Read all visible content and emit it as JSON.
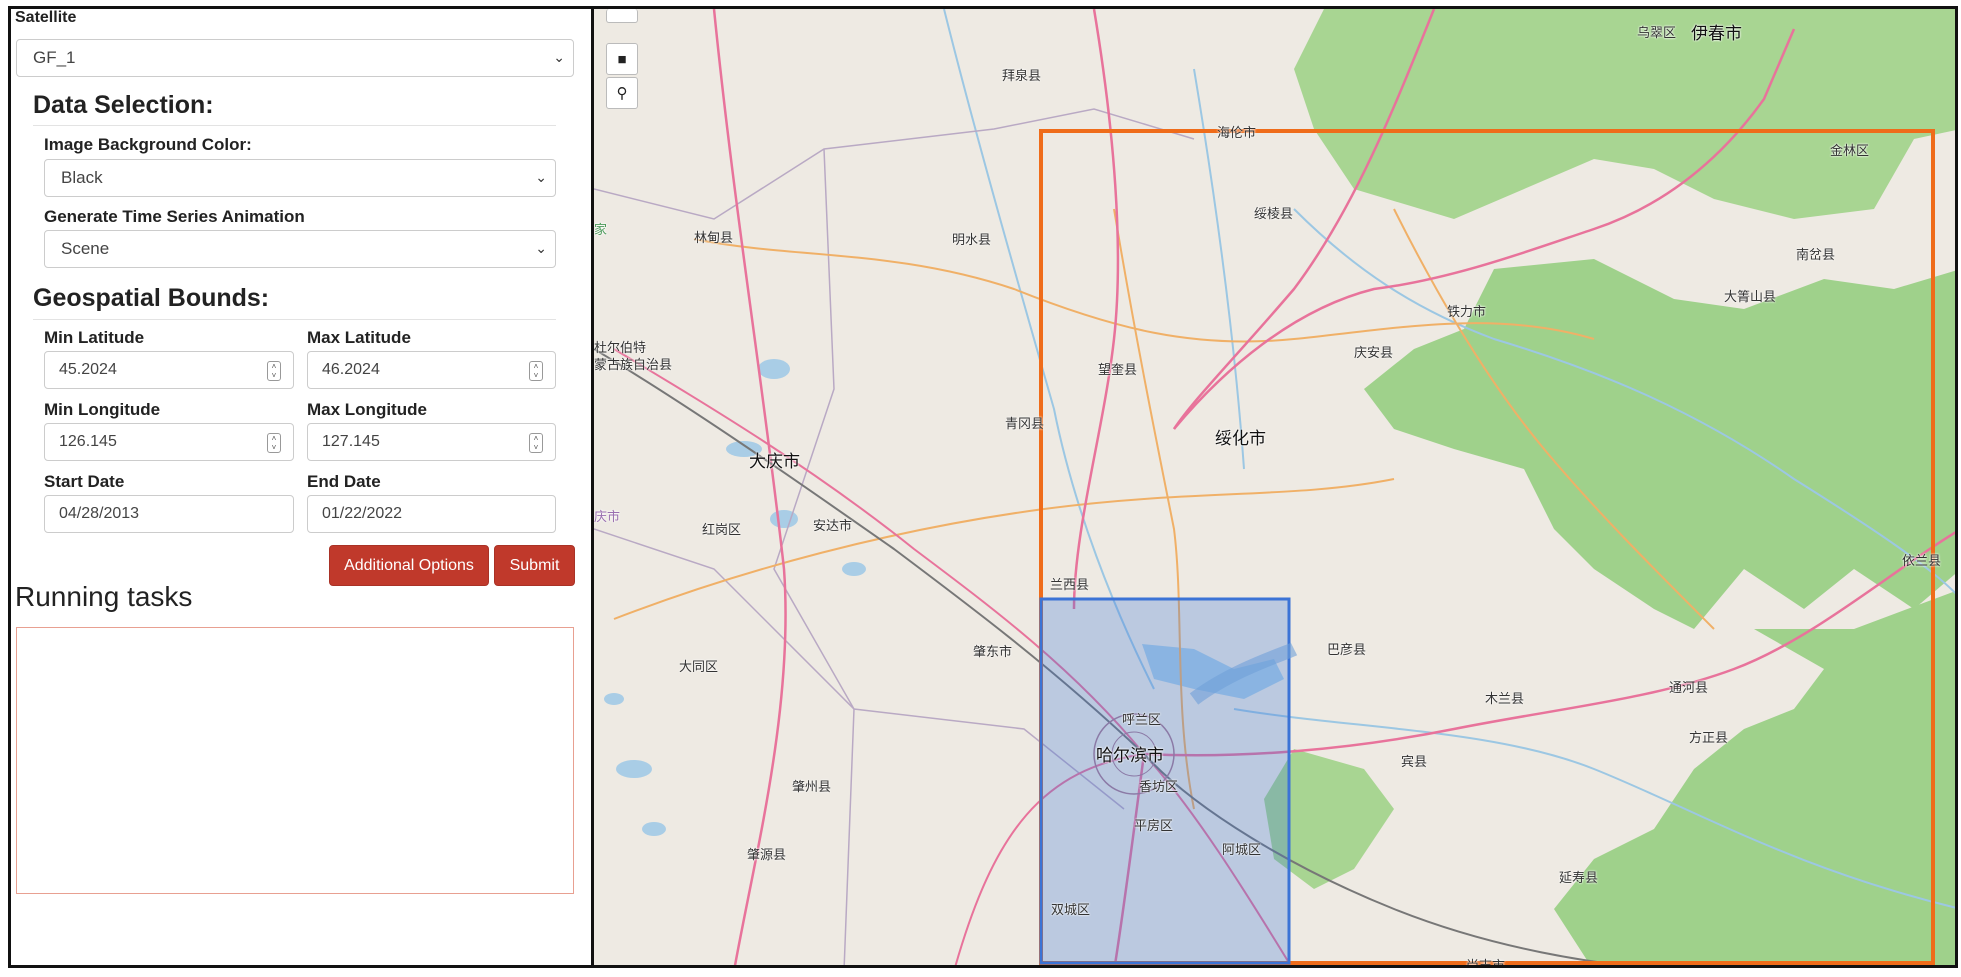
{
  "panel": {
    "satellite": {
      "label": "Satellite",
      "value": "GF_1"
    },
    "data_selection": {
      "heading": "Data Selection:",
      "bg_color": {
        "label": "Image Background Color:",
        "value": "Black"
      },
      "animation": {
        "label": "Generate Time Series Animation",
        "value": "Scene"
      }
    },
    "geo": {
      "heading": "Geospatial Bounds:",
      "min_lat": {
        "label": "Min Latitude",
        "value": "45.2024"
      },
      "max_lat": {
        "label": "Max Latitude",
        "value": "46.2024"
      },
      "min_lon": {
        "label": "Min Longitude",
        "value": "126.145"
      },
      "max_lon": {
        "label": "Max Longitude",
        "value": "127.145"
      },
      "start": {
        "label": "Start Date",
        "value": "04/28/2013"
      },
      "end": {
        "label": "End Date",
        "value": "01/22/2022"
      }
    },
    "buttons": {
      "additional": "Additional Options",
      "submit": "Submit"
    },
    "tasks": {
      "title": "Running tasks"
    }
  },
  "map": {
    "controls": [
      "square-draw-icon",
      "marker-icon"
    ],
    "colors": {
      "orange_box": "#ef6c1a",
      "blue_box": "#3b73d6",
      "forest": "#9fd18b",
      "water": "#a9cde6",
      "roads": "#e8739b"
    },
    "places": {
      "c1": "伊春市",
      "c2": "乌翠区",
      "c3": "拜泉县",
      "c4": "海伦市",
      "c5": "金林区",
      "c6": "林甸县",
      "c7": "明水县",
      "c8": "绥棱县",
      "c9": "南岔县",
      "c10": "铁力市",
      "c11": "大箐山县",
      "c12": "庆安县",
      "c13": "望奎县",
      "c14": "青冈县",
      "c15": "绥化市",
      "c16": "大庆市",
      "c17": "红岗区",
      "c18": "安达市",
      "c19": "兰西县",
      "c20": "依兰县",
      "c21": "巴彦县",
      "c22": "肇东市",
      "c23": "大同区",
      "c24": "呼兰区",
      "c25": "木兰县",
      "c26": "通河县",
      "c27": "哈尔滨市",
      "c28": "方正县",
      "c29": "宾县",
      "c30": "香坊区",
      "c31": "肇州县",
      "c32": "平房区",
      "c33": "阿城区",
      "c34": "肇源县",
      "c35": "延寿县",
      "c36": "双城区",
      "c37": "尚志市",
      "c38": "杜尔伯特",
      "c39": "蒙古族自治县",
      "c40": "庆市",
      "c41": "家"
    }
  }
}
